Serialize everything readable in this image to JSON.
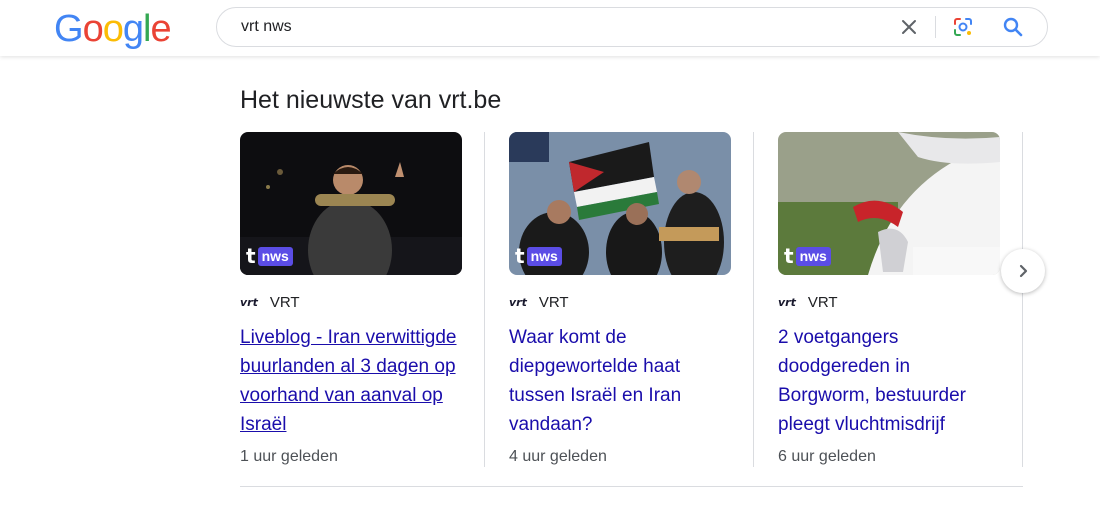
{
  "header": {
    "logo": [
      "G",
      "o",
      "o",
      "g",
      "l",
      "e"
    ],
    "logo_colors": [
      "#4285F4",
      "#EA4335",
      "#FBBC05",
      "#4285F4",
      "#34A853",
      "#EA4335"
    ],
    "search": {
      "value": "vrt nws"
    },
    "icons": {
      "clear": "close-icon",
      "lens": "google-lens-icon",
      "search": "search-icon"
    }
  },
  "section": {
    "title": "Het nieuwste van vrt.be"
  },
  "cards": [
    {
      "badge_t": "t",
      "badge_label": "nws",
      "source_logo": "vrt",
      "source_name": "VRT",
      "headline": "Liveblog - Iran verwittigde buurlanden al 3 dagen op voorhand van aanval op Israël",
      "time": "1 uur geleden"
    },
    {
      "badge_t": "t",
      "badge_label": "nws",
      "source_logo": "vrt",
      "source_name": "VRT",
      "headline": "Waar komt de diepgewortelde haat tussen Israël en Iran vandaan?",
      "time": "4 uur geleden"
    },
    {
      "badge_t": "t",
      "badge_label": "nws",
      "source_logo": "vrt",
      "source_name": "VRT",
      "headline": "2 voetgangers doodgereden in Borgworm, bestuurder pleegt vluchtmisdrijf",
      "time": "6 uur geleden"
    }
  ],
  "carousel": {
    "next_icon": "chevron-right-icon"
  },
  "colors": {
    "link": "#1a0dab",
    "badge": "#5b4de6",
    "text": "#202124",
    "meta": "#4d5156"
  }
}
